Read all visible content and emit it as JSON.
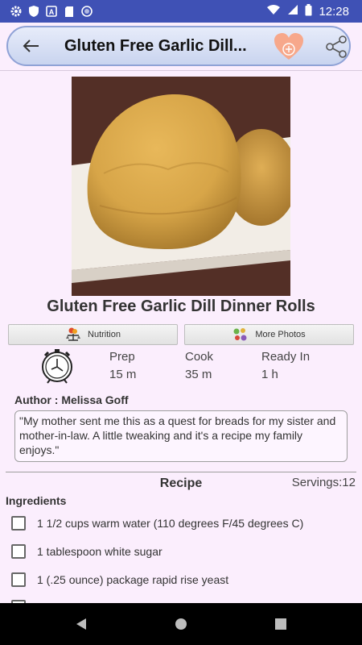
{
  "status_bar": {
    "time": "12:28",
    "icons": [
      "gear-icon",
      "shield-icon",
      "a-box-icon",
      "sd-card-icon",
      "circle-icon",
      "wifi-icon",
      "signal-icon",
      "battery-icon"
    ]
  },
  "toolbar": {
    "title": "Gluten Free Garlic Dill...",
    "back_icon": "arrow-left-icon",
    "favorite_icon": "heart-plus-icon",
    "share_icon": "share-icon",
    "colors": {
      "accent": "#3f51b5",
      "heart": "#f7a88b"
    }
  },
  "recipe": {
    "title": "Gluten Free Garlic Dill Dinner Rolls",
    "buttons": {
      "nutrition": "Nutrition",
      "more_photos": "More Photos"
    },
    "times": {
      "prep_label": "Prep",
      "prep_value": "15 m",
      "cook_label": "Cook",
      "cook_value": "35 m",
      "ready_label": "Ready In",
      "ready_value": "1 h"
    },
    "author": "Author : Melissa Goff",
    "description": "\"My mother sent me this as a quest for breads for my sister and mother-in-law. A little tweaking and it's a recipe my family enjoys.\"",
    "section_heading": "Recipe",
    "servings": "Servings:12",
    "ingredients_heading": "Ingredients",
    "ingredients": [
      "1 1/2 cups warm water (110 degrees F/45 degrees C)",
      "1 tablespoon white sugar",
      "1 (.25 ounce) package rapid rise yeast"
    ]
  },
  "nav_bar": {
    "back": "back-triangle-icon",
    "home": "home-circle-icon",
    "recents": "recents-square-icon"
  }
}
